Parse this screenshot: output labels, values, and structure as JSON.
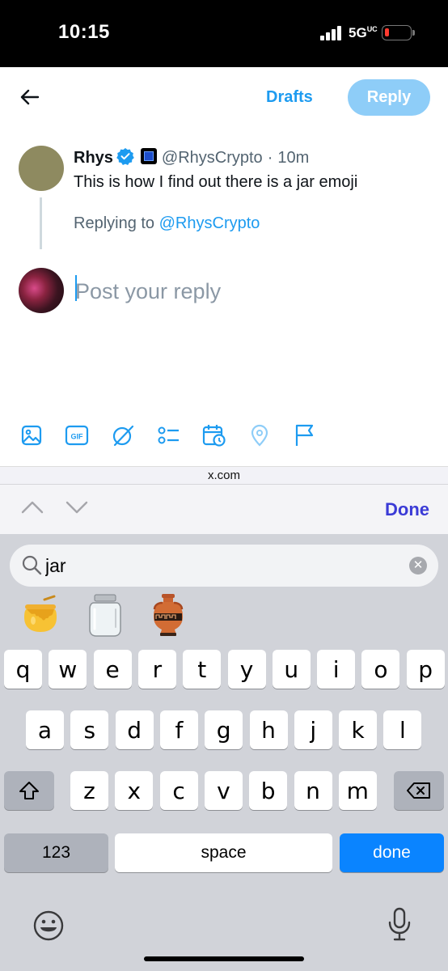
{
  "status": {
    "time": "10:15",
    "network": "5G",
    "network_sup": "UC"
  },
  "header": {
    "drafts_label": "Drafts",
    "reply_label": "Reply"
  },
  "tweet": {
    "name": "Rhys",
    "handle": "@RhysCrypto",
    "separator": "·",
    "age": "10m",
    "text": "This is how I find out there is a jar emoji",
    "replying_prefix": "Replying to",
    "replying_handle": "@RhysCrypto"
  },
  "composer": {
    "placeholder": "Post your reply"
  },
  "toolbar": {
    "icons": [
      "image-icon",
      "gif-icon",
      "grok-icon",
      "poll-icon",
      "schedule-icon",
      "location-icon",
      "flag-icon"
    ],
    "gif_text": "GIF"
  },
  "browser": {
    "url": "x.com",
    "done_label": "Done"
  },
  "emoji_search": {
    "query": "jar",
    "results": [
      "🍯",
      "🫙",
      "🏺"
    ]
  },
  "keyboard": {
    "row1": [
      "q",
      "w",
      "e",
      "r",
      "t",
      "y",
      "u",
      "i",
      "o",
      "p"
    ],
    "row2": [
      "a",
      "s",
      "d",
      "f",
      "g",
      "h",
      "j",
      "k",
      "l"
    ],
    "row3": [
      "z",
      "x",
      "c",
      "v",
      "b",
      "n",
      "m"
    ],
    "numbers_label": "123",
    "space_label": "space",
    "done_label": "done"
  },
  "colors": {
    "accent": "#1d9bf0",
    "reply_button": "#8ecdf8",
    "keyboard_bg": "#d1d3d9",
    "done_key": "#0a84ff"
  }
}
